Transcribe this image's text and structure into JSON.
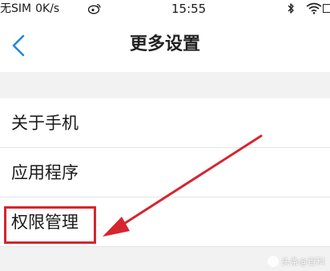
{
  "status_bar": {
    "carrier": "无SIM",
    "speed": "0K/s",
    "time": "15:55"
  },
  "nav": {
    "title": "更多设置",
    "back_icon": "chevron-left-icon"
  },
  "settings_items": [
    {
      "label": "关于手机"
    },
    {
      "label": "应用程序"
    },
    {
      "label": "权限管理"
    }
  ],
  "annotation": {
    "highlighted_item": "权限管理",
    "color": "#d6252f"
  },
  "colors": {
    "accent": "#1e88e5",
    "background": "#f2f2f2",
    "highlight": "#d6252f"
  },
  "watermark": {
    "text": "头条@百科"
  }
}
